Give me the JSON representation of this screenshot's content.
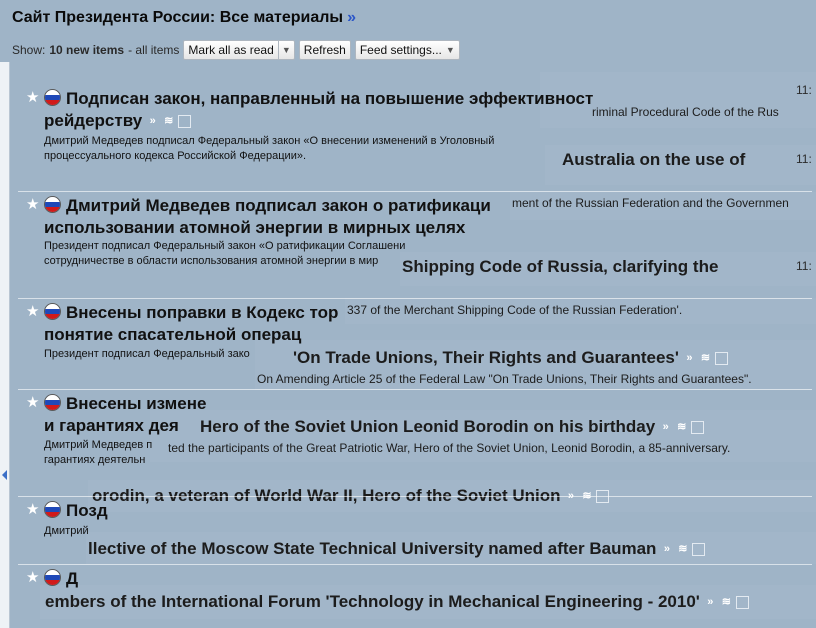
{
  "header": {
    "feed_title": "Сайт Президента России: Все материалы",
    "title_arrow": "»"
  },
  "toolbar": {
    "show_prefix": "Show:",
    "new_items": "10 new items",
    "all_items": "- all items",
    "mark_all_read": "Mark all as read",
    "refresh": "Refresh",
    "feed_settings": "Feed settings...",
    "dropdown_glyph": "▼"
  },
  "items": [
    {
      "title_line1": "Подписан закон, направленный на повышение эффективност",
      "title_line2": "рейдерству",
      "desc_line1": "Дмитрий Медведев подписал Федеральный закон «О внесении изменений в Уголовный",
      "desc_line2": "процессуального кодекса Российской Федерации»."
    },
    {
      "title_line1": "Дмитрий Медведев подписал закон о ратификаци",
      "title_line2": "использовании атомной энергии в мирных целях",
      "desc_line1": "Президент подписал Федеральный закон «О ратификации Соглашени",
      "desc_line2": "сотрудничестве в области использования атомной энергии в мир"
    },
    {
      "title_line1": "Внесены поправки в Кодекс тор",
      "title_line2": "понятие спасательной операц",
      "desc_line1": "Президент подписал Федеральный зако",
      "desc_line2": ""
    },
    {
      "title_line1": "Внесены измене",
      "title_line2": "и гарантиях дея",
      "desc_line1": "Дмитрий Медведев п",
      "desc_line2": "гарантиях деятельн"
    },
    {
      "title_line1": "Позд",
      "title_line2": "",
      "desc_line1": "Дмитрий",
      "desc_line2": ""
    },
    {
      "title_line1": "Д",
      "title_line2": "",
      "desc_line1": "",
      "desc_line2": ""
    }
  ],
  "ghost_english": [
    {
      "text": "riminal Procedural Code of the Rus",
      "kind": "sub"
    },
    {
      "text": "Australia on the use of",
      "kind": "title"
    },
    {
      "text": "ment of the Russian Federation and the Governmen",
      "kind": "sub"
    },
    {
      "text": "Shipping Code of Russia, clarifying the",
      "kind": "title"
    },
    {
      "text": "337 of the Merchant Shipping Code of the Russian Federation'.",
      "kind": "sub"
    },
    {
      "text": "'On Trade Unions, Their Rights and Guarantees'",
      "kind": "title"
    },
    {
      "text": "On Amending Article 25 of the Federal Law \"On Trade Unions, Their Rights and Guarantees\".",
      "kind": "sub"
    },
    {
      "text": "Hero of the Soviet Union Leonid Borodin on his birthday",
      "kind": "title"
    },
    {
      "text": "ted the participants of the Great Patriotic War, Hero of the Soviet Union, Leonid Borodin, a 85-anniversary.",
      "kind": "sub"
    },
    {
      "text": "orodin, a veteran of World War II, Hero of the Soviet Union",
      "kind": "title"
    },
    {
      "text": "llective of the Moscow State Technical University named after Bauman",
      "kind": "title"
    },
    {
      "text": "embers of the International Forum 'Technology in Mechanical Engineering - 2010'",
      "kind": "title"
    }
  ],
  "times": [
    "11:",
    "11:",
    "11:"
  ],
  "icons": {
    "star": "★",
    "forward": "»",
    "expand": "≋"
  },
  "colors": {
    "background": "#9fb4c7",
    "link_blue": "#2a55c8",
    "flag_white": "#ffffff",
    "flag_blue": "#1f49b8",
    "flag_red": "#d11a1a"
  }
}
